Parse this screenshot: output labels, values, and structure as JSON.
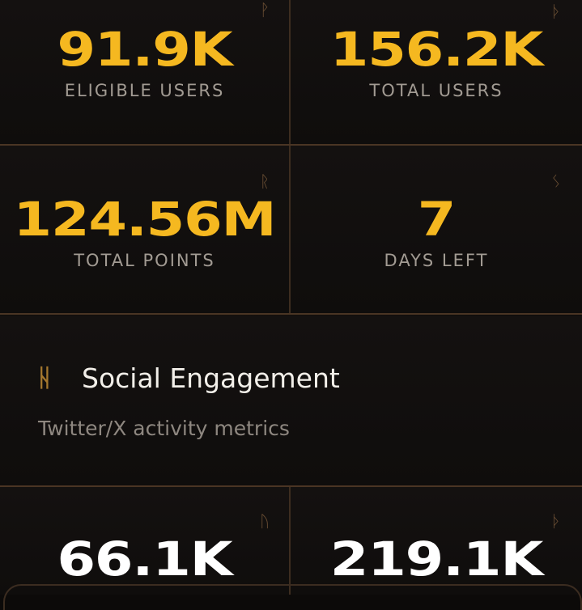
{
  "stats": [
    {
      "value": "91.9K",
      "label": "ELIGIBLE USERS",
      "rune": "ᚹ"
    },
    {
      "value": "156.2K",
      "label": "TOTAL USERS",
      "rune": "ᚦ"
    },
    {
      "value": "124.56M",
      "label": "TOTAL POINTS",
      "rune": "ᚱ"
    },
    {
      "value": "7",
      "label": "DAYS LEFT",
      "rune": "ᛊ"
    }
  ],
  "social": {
    "icon": "ᚺ",
    "title": "Social Engagement",
    "subtitle": "Twitter/X activity metrics",
    "stats": [
      {
        "value": "66.1K",
        "rune": "ᚢ"
      },
      {
        "value": "219.1K",
        "rune": "ᚦ"
      }
    ]
  },
  "colors": {
    "accent_gold": "#f5b820",
    "divider": "#4a3524",
    "label": "#a29b93"
  }
}
